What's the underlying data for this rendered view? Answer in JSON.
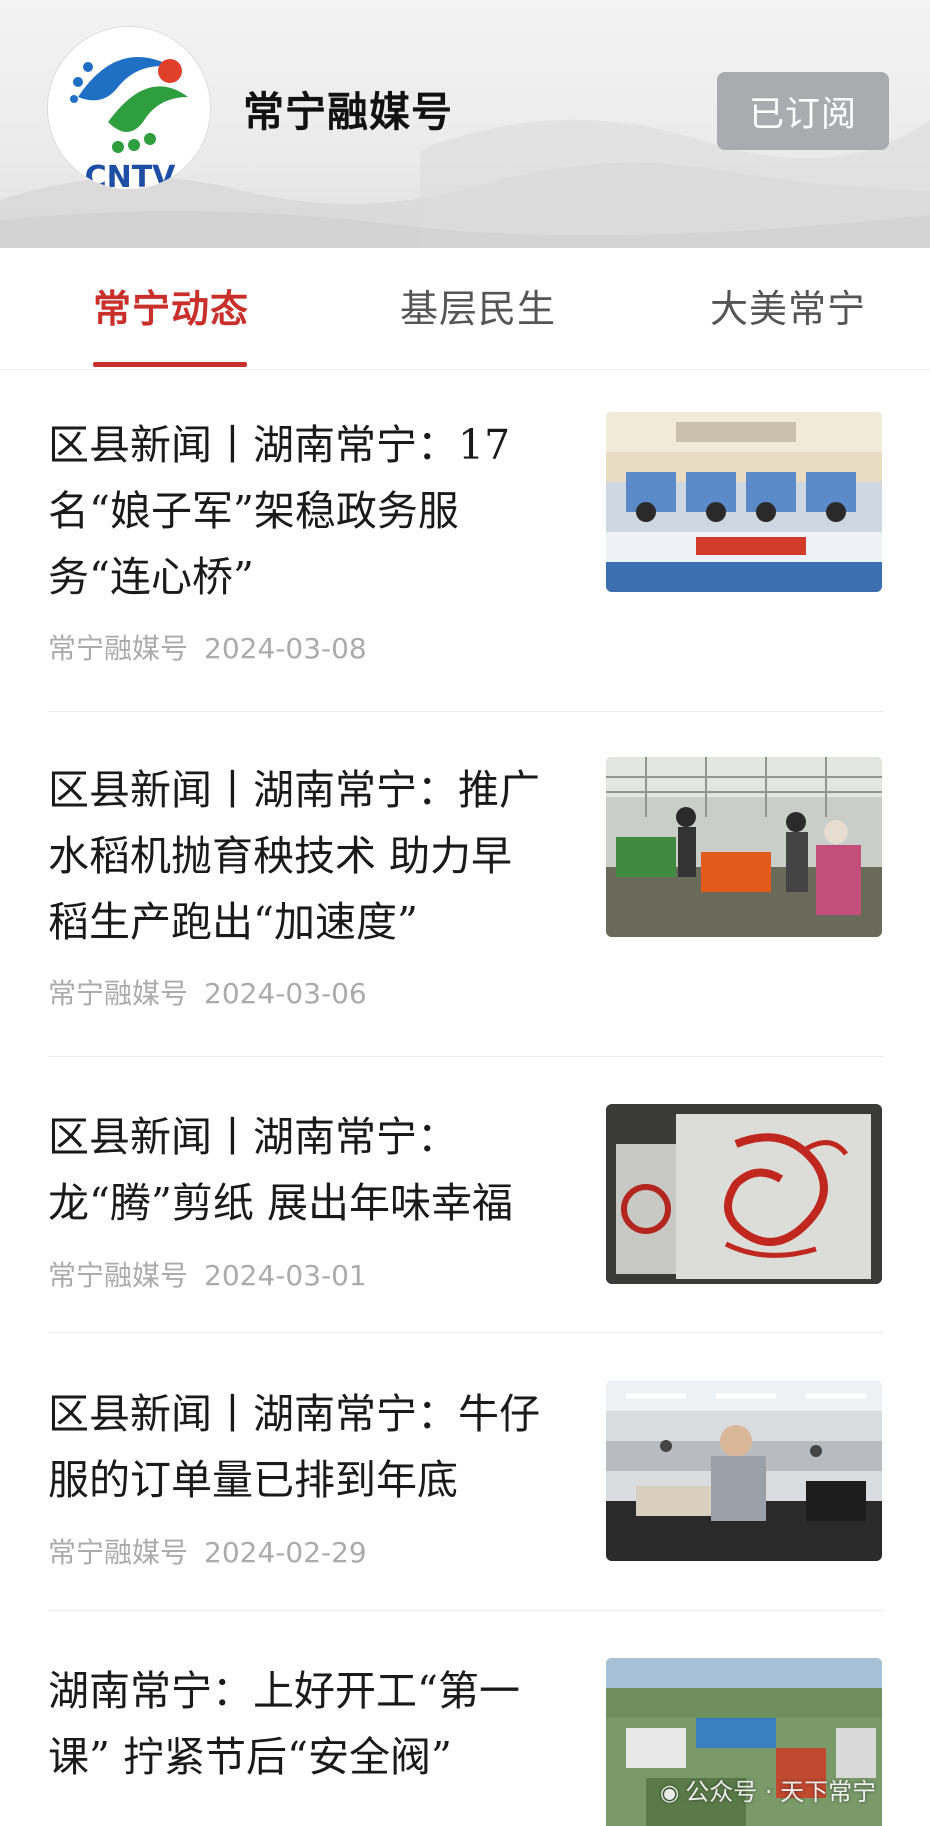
{
  "channel": {
    "logo_text": "CNTV",
    "name": "常宁融媒号",
    "subscribe_label": "已订阅"
  },
  "tabs": [
    {
      "label": "常宁动态",
      "active": true
    },
    {
      "label": "基层民生",
      "active": false
    },
    {
      "label": "大美常宁",
      "active": false
    }
  ],
  "colors": {
    "accent": "#c9302c",
    "subscribe_bg": "#a9abae",
    "meta_text": "#ababab"
  },
  "articles": [
    {
      "title": "区县新闻丨湖南常宁：17名“娘子军”架稳政务服务“连心桥”",
      "source": "常宁融媒号",
      "date": "2024-03-08",
      "thumbnail_icon": "service-hall-photo-icon"
    },
    {
      "title": "区县新闻丨湖南常宁：推广水稻机抛育秧技术 助力早稻生产跑出“加速度”",
      "source": "常宁融媒号",
      "date": "2024-03-06",
      "thumbnail_icon": "greenhouse-photo-icon"
    },
    {
      "title": "区县新闻丨湖南常宁：龙“腾”剪纸 展出年味幸福",
      "source": "常宁融媒号",
      "date": "2024-03-01",
      "thumbnail_icon": "papercut-dragon-photo-icon"
    },
    {
      "title": "区县新闻丨湖南常宁：牛仔服的订单量已排到年底",
      "source": "常宁融媒号",
      "date": "2024-02-29",
      "thumbnail_icon": "factory-photo-icon"
    },
    {
      "title": "湖南常宁：上好开工“第一课” 拧紧节后“安全阀”",
      "source": "",
      "date": "",
      "thumbnail_icon": "aerial-town-photo-icon"
    }
  ],
  "watermark": {
    "text": "公众号 · 天下常宁"
  }
}
